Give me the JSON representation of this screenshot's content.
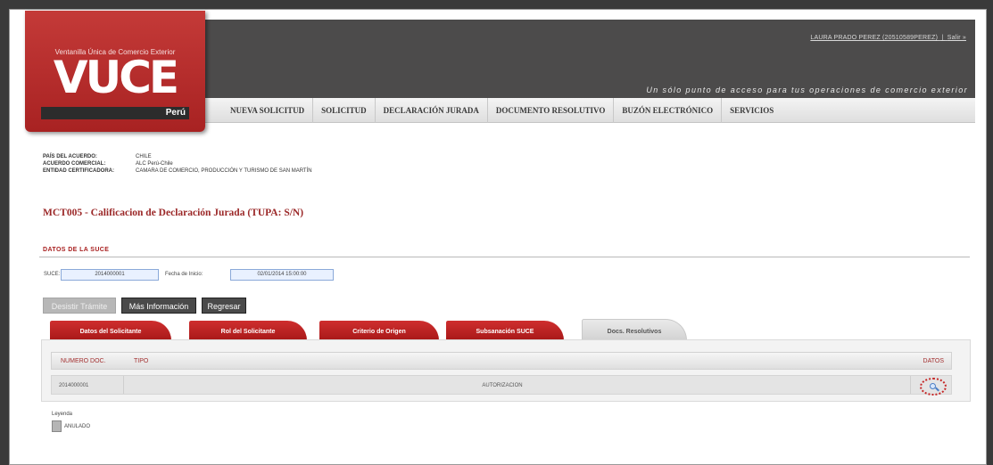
{
  "header": {
    "user_link": "LAURA PRADO PEREZ (20510589PEREZ)",
    "exit_link": "Salir »",
    "tagline": "Un sólo punto de acceso para tus operaciones de comercio exterior"
  },
  "logo": {
    "subtitle": "Ventanilla Única de Comercio Exterior",
    "name": "VUCE",
    "country": "Perú"
  },
  "nav": {
    "items": [
      "NUEVA SOLICITUD",
      "SOLICITUD",
      "DECLARACIÓN JURADA",
      "DOCUMENTO RESOLUTIVO",
      "BUZÓN ELECTRÓNICO",
      "SERVICIOS"
    ]
  },
  "info": {
    "pais_label": "PAÍS DEL ACUERDO:",
    "pais_value": "CHILE",
    "acuerdo_label": "ACUERDO COMERCIAL:",
    "acuerdo_value": "ALC Perú-Chile",
    "entidad_label": "ENTIDAD CERTIFICADORA:",
    "entidad_value": "CAMARA DE COMERCIO, PRODUCCIÓN Y TURISMO DE SAN MARTÍN"
  },
  "page_title": "MCT005 - Calificacion de Declaración Jurada (TUPA: S/N)",
  "section": {
    "title": "DATOS DE LA SUCE",
    "suce_label": "SUCE:",
    "suce_value": "2014000001",
    "fecha_label": "Fecha de Inicio:",
    "fecha_value": "02/01/2014 15:00:00"
  },
  "buttons": {
    "desistimiento": "Desistir Trámite",
    "mas_info": "Más Información",
    "regresar": "Regresar"
  },
  "tabs": [
    "Datos del Solicitante",
    "Rol del Solicitante",
    "Criterio de Origen",
    "Subsanación SUCE",
    "Docs. Resolutivos"
  ],
  "table": {
    "headers": {
      "numero": "NUMERO DOC.",
      "tipo": "TIPO",
      "datos": "DATOS"
    },
    "rows": [
      {
        "numero": "2014000001",
        "tipo": "AUTORIZACION"
      }
    ]
  },
  "legend": {
    "label": "Leyenda",
    "item": "ANULADO"
  },
  "colors": {
    "brand_red": "#b32b2b",
    "header_dark": "#4c4b4b",
    "accent_blue": "#8aa9d9"
  }
}
